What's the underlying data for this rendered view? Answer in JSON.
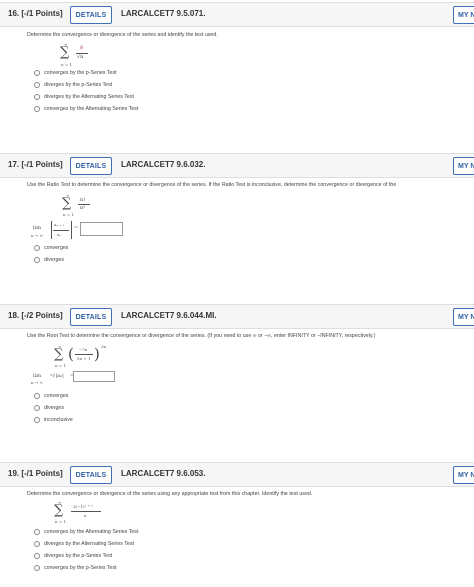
{
  "questions": [
    {
      "number": "16. [-/1 Points]",
      "details_label": "DETAILS",
      "code": "LARCALCET7 9.5.071.",
      "my_label": "MY N",
      "prompt": "Determine the convergence or divergence of the series and identify the test used.",
      "series": {
        "sum_top": "∞",
        "sum_bottom": "n = 1",
        "numerator": "8",
        "denominator": "√n"
      },
      "options": [
        "converges by the p-Series Test",
        "diverges by the p-Series Test",
        "diverges by the Alternating Series Test",
        "converges by the Alternating Series Test"
      ]
    },
    {
      "number": "17. [-/1 Points]",
      "details_label": "DETAILS",
      "code": "LARCALCET7 9.6.032.",
      "my_label": "MY N",
      "prompt": "Use the Ratio Test to determine the convergence or divergence of the series. If the Ratio Test is inconclusive, determine the convergence or divergence of the",
      "series": {
        "sum_top": "∞",
        "sum_bottom": "n = 1",
        "numerator": "n!",
        "denominator": "n⁵"
      },
      "limit": {
        "lim": "lim",
        "sub": "n → ∞",
        "top": "aₙ ₊ ₁",
        "bottom": "aₙ",
        "equals": "="
      },
      "options": [
        "converges",
        "diverges"
      ]
    },
    {
      "number": "18. [-/2 Points]",
      "details_label": "DETAILS",
      "code": "LARCALCET7 9.6.044.MI.",
      "my_label": "MY N",
      "prompt": "Use the Root Test to determine the convergence or divergence of the series. (If you need to use ∞ or −∞, enter INFINITY or −INFINITY, respectively.)",
      "series": {
        "sum_top": "∞",
        "sum_bottom": "n = 1",
        "numerator": "−7n",
        "denominator": "5n + 1",
        "power": "3n"
      },
      "limit": {
        "lim": "lim",
        "sub": "n → ∞",
        "radical": "ⁿ√|aₙ|",
        "equals": "="
      },
      "options": [
        "converges",
        "diverges",
        "inconclusive"
      ]
    },
    {
      "number": "19. [-/1 Points]",
      "details_label": "DETAILS",
      "code": "LARCALCET7 9.6.053.",
      "my_label": "MY N",
      "prompt": "Determine the convergence or divergence of the series using any appropriate test from this chapter. Identify the test used.",
      "series": {
        "sum_top": "∞",
        "sum_bottom": "n = 1",
        "numerator": "3(−1)ⁿ ⁺ ³",
        "denominator": "n"
      },
      "options": [
        "converges by the Alternating Series Test",
        "diverges by the Alternating Series Test",
        "diverges by the p-Series Test",
        "converges by the p-Series Test"
      ]
    }
  ]
}
